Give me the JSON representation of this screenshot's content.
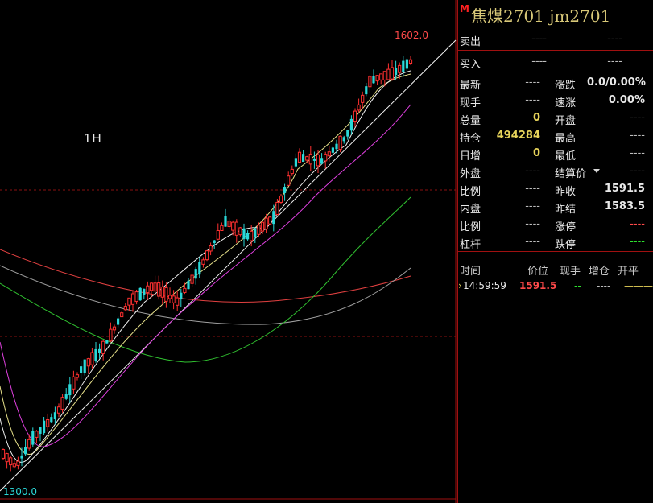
{
  "chart": {
    "timeframe": "1H",
    "high_label": "1602.0",
    "low_label": "1300.0"
  },
  "panel": {
    "marker": "M",
    "title": "焦煤2701  jm2701",
    "sell": {
      "label": "卖出",
      "price": "----",
      "volume": "----"
    },
    "buy": {
      "label": "买入",
      "price": "----",
      "volume": "----"
    },
    "stats": [
      {
        "l1": "最新",
        "v1": "----",
        "l2": "涨跌",
        "v2": "0.0/0.00%"
      },
      {
        "l1": "现手",
        "v1": "----",
        "l2": "速涨",
        "v2": "0.00%"
      },
      {
        "l1": "总量",
        "v1": "0",
        "l2": "开盘",
        "v2": "----"
      },
      {
        "l1": "持仓",
        "v1": "494284",
        "l2": "最高",
        "v2": "----"
      },
      {
        "l1": "日增",
        "v1": "0",
        "l2": "最低",
        "v2": "----"
      },
      {
        "l1": "外盘",
        "v1": "----",
        "l2": "结算价",
        "v2": "----"
      },
      {
        "l1": "比例",
        "v1": "----",
        "l2": "昨收",
        "v2": "1591.5"
      },
      {
        "l1": "内盘",
        "v1": "----",
        "l2": "昨结",
        "v2": "1583.5"
      },
      {
        "l1": "比例",
        "v1": "----",
        "l2": "涨停",
        "v2": "----"
      },
      {
        "l1": "杠杆",
        "v1": "----",
        "l2": "跌停",
        "v2": "----"
      }
    ],
    "ticks_header": {
      "time": "时间",
      "price": "价位",
      "hand": "现手",
      "oi": "增仓",
      "type": "开平"
    },
    "tick": {
      "time": "14:59:59",
      "price": "1591.5",
      "hand": "--",
      "oi": "----",
      "type": "———"
    }
  },
  "colors": {
    "up": "#ff3030",
    "down": "#2ad8d8",
    "ma_white": "#f0f0f0",
    "ma_yellow": "#e6e08a",
    "ma_magenta": "#e040e0",
    "ma_green": "#30c030",
    "ma_red": "#e04040",
    "ma_gray": "#a0a0a0",
    "frame": "#a01010"
  }
}
